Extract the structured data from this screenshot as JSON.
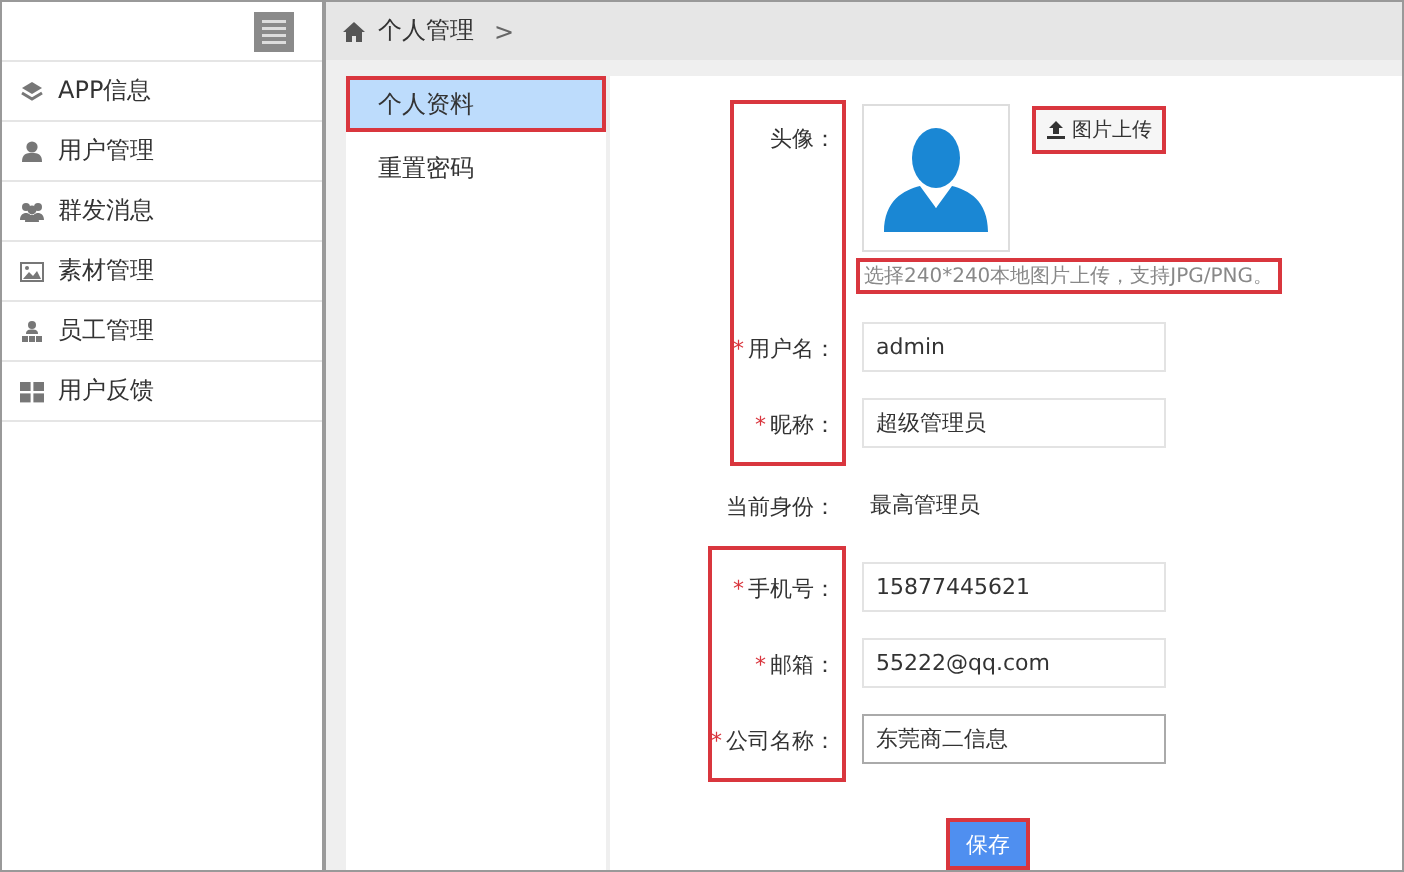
{
  "sidebar": {
    "items": [
      {
        "label": "APP信息"
      },
      {
        "label": "用户管理"
      },
      {
        "label": "群发消息"
      },
      {
        "label": "素材管理"
      },
      {
        "label": "员工管理"
      },
      {
        "label": "用户反馈"
      }
    ]
  },
  "breadcrumb": {
    "items": [
      "个人管理"
    ],
    "separator": ">"
  },
  "subnav": {
    "items": [
      {
        "label": "个人资料",
        "selected": true,
        "highlighted": true
      },
      {
        "label": "重置密码",
        "selected": false,
        "highlighted": false
      }
    ]
  },
  "form": {
    "groups": [
      {
        "highlighted": true,
        "rows": [
          {
            "kind": "avatar",
            "label": "头像：",
            "upload_button": {
              "label": "图片上传",
              "highlighted": true
            },
            "hint": {
              "text": "选择240*240本地图片上传，支持JPG/PNG。",
              "highlighted": true
            }
          },
          {
            "kind": "field",
            "required_mark": "*",
            "label": "用户名：",
            "value": "admin",
            "focused": false
          },
          {
            "kind": "field",
            "required_mark": "*",
            "label": "昵称：",
            "value": "超级管理员",
            "focused": false
          }
        ]
      },
      {
        "highlighted": false,
        "rows": [
          {
            "kind": "text",
            "label": "当前身份：",
            "value": "最高管理员"
          }
        ]
      },
      {
        "highlighted": true,
        "rows": [
          {
            "kind": "field",
            "required_mark": "*",
            "label": "手机号：",
            "value": "15877445621",
            "focused": false
          },
          {
            "kind": "field",
            "required_mark": "*",
            "label": "邮箱：",
            "value": "55222@qq.com",
            "focused": false
          },
          {
            "kind": "field",
            "required_mark": "*",
            "label": "公司名称：",
            "value": "东莞商二信息",
            "focused": true
          }
        ]
      }
    ],
    "save_button": {
      "label": "保存",
      "highlighted": true
    }
  }
}
